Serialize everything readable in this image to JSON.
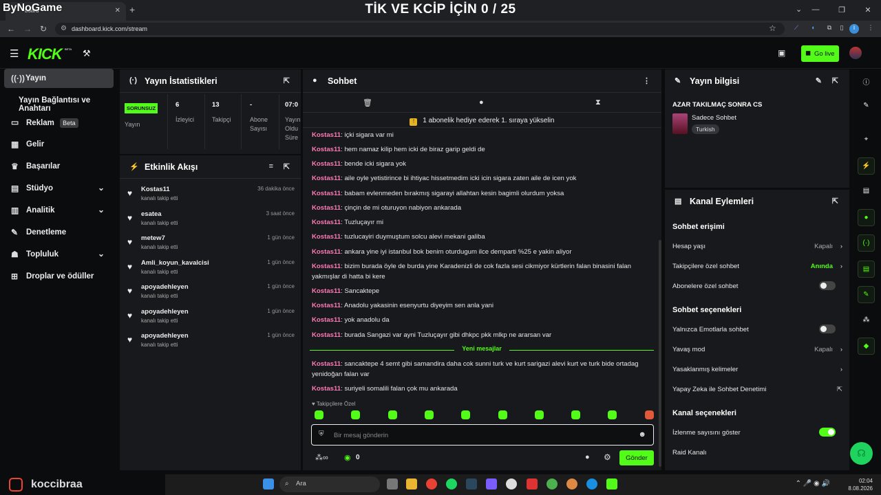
{
  "browser": {
    "tab_title": "board",
    "new_tab": "+",
    "url": "dashboard.kick.com/stream",
    "overlay_brand": "ByNoGame",
    "overlay_title": "TİK VE KCİP İÇİN 0 / 25"
  },
  "topbar": {
    "logo": "KICK",
    "beta": "BETA",
    "go_live": "Go live"
  },
  "sidebar": {
    "items": [
      {
        "label": "Yayın",
        "icon": "broadcast-icon"
      },
      {
        "label": "Yayın Bağlantısı ve Anahtarı"
      },
      {
        "label": "Reklam",
        "badge": "Beta",
        "icon": "ad-icon"
      },
      {
        "label": "Gelir",
        "icon": "chart-icon"
      },
      {
        "label": "Başarılar",
        "icon": "trophy-icon"
      },
      {
        "label": "Stüdyo",
        "icon": "studio-icon"
      },
      {
        "label": "Analitik",
        "icon": "analytics-icon"
      },
      {
        "label": "Denetleme",
        "icon": "wrench-icon"
      },
      {
        "label": "Topluluk",
        "icon": "community-icon"
      },
      {
        "label": "Droplar ve ödüller",
        "icon": "drops-icon"
      }
    ]
  },
  "stats": {
    "title": "Yayın İstatistikleri",
    "status_badge": "SORUNSUZ",
    "cells": [
      {
        "value": "",
        "label": "Yayın"
      },
      {
        "value": "6",
        "label": "İzleyici"
      },
      {
        "value": "13",
        "label": "Takipçi"
      },
      {
        "value": "-",
        "label": "Abone Sayısı"
      },
      {
        "value": "07:0",
        "label": "Yayın Oldu Süre"
      }
    ]
  },
  "activity": {
    "title": "Etkinlik Akışı",
    "items": [
      {
        "user": "Kostas11",
        "what": "kanalı takip etti",
        "when": "36 dakika önce"
      },
      {
        "user": "esatea",
        "what": "kanalı takip etti",
        "when": "3 saat önce"
      },
      {
        "user": "metew7",
        "what": "kanalı takip etti",
        "when": "1 gün önce"
      },
      {
        "user": "Amli_koyun_kavalcisi",
        "what": "kanalı takip etti",
        "when": "1 gün önce"
      },
      {
        "user": "apoyadehleyen",
        "what": "kanalı takip etti",
        "when": "1 gün önce"
      },
      {
        "user": "apoyadehleyen",
        "what": "kanalı takip etti",
        "when": "1 gün önce"
      },
      {
        "user": "apoyadehleyen",
        "what": "kanalı takip etti",
        "when": "1 gün önce"
      }
    ]
  },
  "chat": {
    "title": "Sohbet",
    "pinned": "1 abonelik hediye ederek 1. sıraya yükselin",
    "messages": [
      {
        "user": "Kostas11",
        "text": ": içki sigara var mi"
      },
      {
        "user": "Kostas11",
        "text": ": hem namaz kilip hem icki de biraz garip geldi de"
      },
      {
        "user": "Kostas11",
        "text": ": bende icki sigara yok"
      },
      {
        "user": "Kostas11",
        "text": ": aile oyle yetistirince bi ihtiyac hissetmedim icki icin sigara zaten aile de icen yok"
      },
      {
        "user": "Kostas11",
        "text": ": babam evlenmeden bırakmış sigarayi allahtan kesin bagimli olurdum yoksa"
      },
      {
        "user": "Kostas11",
        "text": ": çinçin de mi oturuyon nabiyon ankarada"
      },
      {
        "user": "Kostas11",
        "text": ": Tuzluçayır mi"
      },
      {
        "user": "Kostas11",
        "text": ": tuzlucayiri duymuştum solcu alevi mekani galiba"
      },
      {
        "user": "Kostas11",
        "text": ": ankara yine iyi istanbul bok benim oturdugum ilce demparti %25 e yakin aliyor"
      },
      {
        "user": "Kostas11",
        "text": ": bizim burada öyle de burda yine Karadenizli de cok fazla sesi cikmiyor kürtlerin falan binasini falan yakmışlar di hatta bi kere"
      },
      {
        "user": "Kostas11",
        "text": ": Sancaktepe"
      },
      {
        "user": "Kostas11",
        "text": ": Anadolu yakasinin esenyurtu diyeyim sen anla yani"
      },
      {
        "user": "Kostas11",
        "text": ": yok anadolu da"
      },
      {
        "user": "Kostas11",
        "text": ": burada Sangazi var ayni Tuzluçayır gibi dhkpc pkk mlkp ne ararsan var"
      }
    ],
    "new_messages_label": "Yeni mesajlar",
    "new_messages": [
      {
        "user": "Kostas11",
        "text": ": sancaktepe 4 semt gibi samandira daha cok sunni turk ve kurt sarigazi alevi kurt ve turk bide ortadag yenidoğan falan var"
      },
      {
        "user": "Kostas11",
        "text": ": suriyeli somalili falan çok mu ankarada"
      }
    ],
    "followers_only": "♥ Takipçilere Özel",
    "input_placeholder": "Bir mesaj gönderin",
    "points": "0",
    "send": "Gönder"
  },
  "stream_info": {
    "title": "Yayın bilgisi",
    "stream_title": "AZAR TAKILMAÇ SONRA CS",
    "category": "Sadece Sohbet",
    "language": "Turkish"
  },
  "channel_actions": {
    "title": "Kanal Eylemleri",
    "section1": "Sohbet erişimi",
    "hesap_yasi": "Hesap yaşı",
    "hesap_yasi_val": "Kapalı",
    "takipci_sohbet": "Takipçilere özel sohbet",
    "takipci_sohbet_val": "Anında",
    "abone_sohbet": "Abonelere özel sohbet",
    "section2": "Sohbet seçenekleri",
    "emote_sohbet": "Yalnızca Emotlarla sohbet",
    "yavas_mod": "Yavaş mod",
    "yavas_mod_val": "Kapalı",
    "yasak_kelime": "Yasaklanmış kelimeler",
    "ai_denetim": "Yapay Zeka ile Sohbet Denetimi",
    "section3": "Kanal seçenekleri",
    "izlenme": "İzlenme sayısını göster",
    "raid": "Raid Kanalı"
  },
  "watermark": {
    "name": "koccibraa"
  },
  "taskbar": {
    "search": "Ara",
    "time": "02:04",
    "date": "8.08.2026"
  },
  "colors": {
    "accent": "#53fc18",
    "username": "#ff7ab8",
    "panel": "#18191c"
  }
}
